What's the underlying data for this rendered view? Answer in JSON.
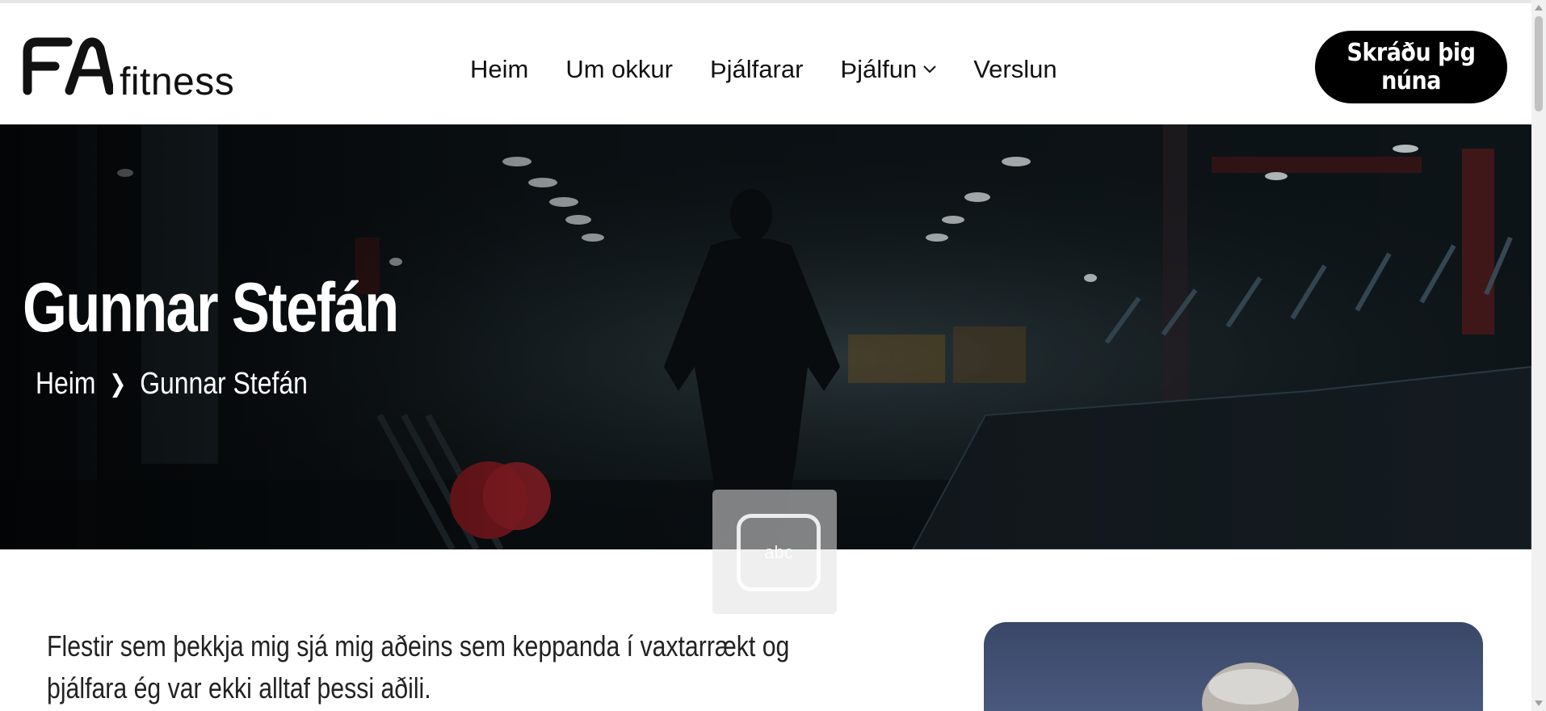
{
  "header": {
    "logo_text": "fitness",
    "logo_mark": "FA",
    "nav": [
      {
        "label": "Heim"
      },
      {
        "label": "Um okkur"
      },
      {
        "label": "Þjálfarar"
      },
      {
        "label": "Þjálfun",
        "has_dropdown": true
      },
      {
        "label": "Verslun"
      }
    ],
    "cta_label": "Skráðu þig núna"
  },
  "hero": {
    "title": "Gunnar Stefán",
    "breadcrumb": {
      "home": "Heim",
      "separator_icon": "chevron-right-icon",
      "current": "Gunnar Stefán"
    }
  },
  "floating_widget": {
    "text": "abc"
  },
  "content": {
    "intro": "Flestir sem þekkja mig sjá mig aðeins sem keppanda í vaxtarrækt og þjálfara ég var ekki alltaf þessi aðili."
  },
  "colors": {
    "cta_bg": "#000000",
    "hero_bg": "#0e1418",
    "portrait_bg": "#3a4767"
  }
}
